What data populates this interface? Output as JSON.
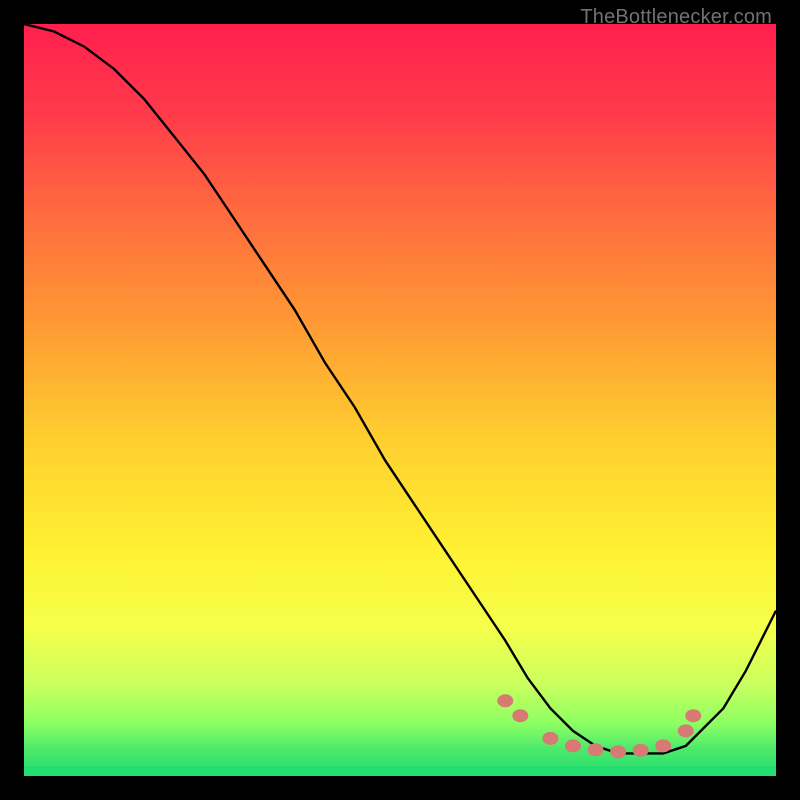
{
  "watermark": "TheBottlenecker.com",
  "colors": {
    "bg": "#000000",
    "curve": "#000000",
    "dot_fill": "#d87a74",
    "dot_stroke": "#d87a74",
    "bottom_band": "#24dd6e"
  },
  "chart_data": {
    "type": "line",
    "title": "",
    "xlabel": "",
    "ylabel": "",
    "xlim": [
      0,
      100
    ],
    "ylim": [
      0,
      100
    ],
    "grid": false,
    "legend": false,
    "background_gradient_stops": [
      {
        "pos": 0.0,
        "color": "#ff1f4e"
      },
      {
        "pos": 0.12,
        "color": "#ff3b4a"
      },
      {
        "pos": 0.25,
        "color": "#ff6a3f"
      },
      {
        "pos": 0.4,
        "color": "#ff9a34"
      },
      {
        "pos": 0.55,
        "color": "#ffce2f"
      },
      {
        "pos": 0.7,
        "color": "#fff133"
      },
      {
        "pos": 0.8,
        "color": "#f6ff4a"
      },
      {
        "pos": 0.88,
        "color": "#c8ff5e"
      },
      {
        "pos": 0.93,
        "color": "#8dff63"
      },
      {
        "pos": 0.965,
        "color": "#4be96b"
      },
      {
        "pos": 1.0,
        "color": "#24dd6e"
      }
    ],
    "series": [
      {
        "name": "bottleneck-curve",
        "x": [
          0,
          4,
          8,
          12,
          16,
          20,
          24,
          28,
          32,
          36,
          40,
          44,
          48,
          52,
          56,
          60,
          64,
          67,
          70,
          73,
          76,
          79,
          82,
          85,
          88,
          90,
          93,
          96,
          100
        ],
        "y": [
          100,
          99,
          97,
          94,
          90,
          85,
          80,
          74,
          68,
          62,
          55,
          49,
          42,
          36,
          30,
          24,
          18,
          13,
          9,
          6,
          4,
          3,
          3,
          3,
          4,
          6,
          9,
          14,
          22
        ]
      }
    ],
    "dots": [
      {
        "x": 64,
        "y": 10
      },
      {
        "x": 66,
        "y": 8
      },
      {
        "x": 70,
        "y": 5
      },
      {
        "x": 73,
        "y": 4
      },
      {
        "x": 76,
        "y": 3.5
      },
      {
        "x": 79,
        "y": 3.2
      },
      {
        "x": 82,
        "y": 3.4
      },
      {
        "x": 85,
        "y": 4
      },
      {
        "x": 88,
        "y": 6
      },
      {
        "x": 89,
        "y": 8
      }
    ]
  }
}
